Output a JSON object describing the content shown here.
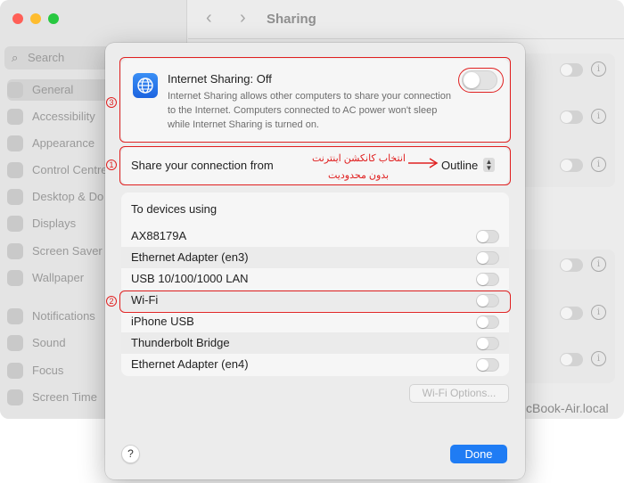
{
  "background": {
    "toolbar_title": "Sharing",
    "search_placeholder": "Search",
    "sidebar_items": [
      {
        "label": "General",
        "icon": "gear-icon"
      },
      {
        "label": "Accessibility",
        "icon": "accessibility-icon"
      },
      {
        "label": "Appearance",
        "icon": "appearance-icon"
      },
      {
        "label": "Control Centre",
        "icon": "control-centre-icon"
      },
      {
        "label": "Desktop & Do",
        "icon": "desktop-dock-icon"
      },
      {
        "label": "Displays",
        "icon": "displays-icon"
      },
      {
        "label": "Screen Saver",
        "icon": "screen-saver-icon"
      },
      {
        "label": "Wallpaper",
        "icon": "wallpaper-icon"
      },
      {
        "label": "Notifications",
        "icon": "notifications-icon"
      },
      {
        "label": "Sound",
        "icon": "sound-icon"
      },
      {
        "label": "Focus",
        "icon": "focus-icon"
      },
      {
        "label": "Screen Time",
        "icon": "screen-time-icon"
      }
    ],
    "hostname": "cBook-Air.local"
  },
  "sheet": {
    "internet_sharing_title": "Internet Sharing: Off",
    "internet_sharing_desc": "Internet Sharing allows other computers to share your connection to the Internet. Computers connected to AC power won't sleep while Internet Sharing is turned on.",
    "share_from_label": "Share your connection from",
    "share_from_value": "Outline",
    "annotation_line1": "انتخاب کانکشن اینترنت",
    "annotation_line2": "بدون محدودیت",
    "devices_heading": "To devices using",
    "devices": [
      {
        "label": "AX88179A",
        "on": false
      },
      {
        "label": "Ethernet Adapter (en3)",
        "on": false
      },
      {
        "label": "USB 10/100/1000 LAN",
        "on": false
      },
      {
        "label": "Wi-Fi",
        "on": false
      },
      {
        "label": "iPhone USB",
        "on": false
      },
      {
        "label": "Thunderbolt Bridge",
        "on": false
      },
      {
        "label": "Ethernet Adapter (en4)",
        "on": false
      }
    ],
    "wifi_options_label": "Wi-Fi Options...",
    "help_label": "?",
    "done_label": "Done",
    "badges": [
      "1",
      "2",
      "3"
    ]
  },
  "colors": {
    "accent": "#1f7cf4",
    "annotation": "#e02020"
  }
}
